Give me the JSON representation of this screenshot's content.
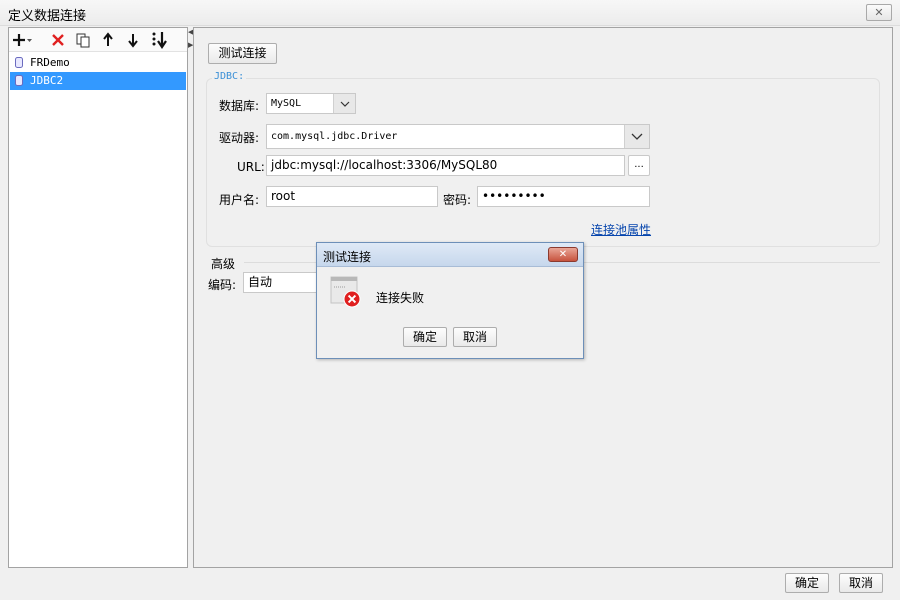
{
  "window": {
    "title": "定义数据连接",
    "close_glyph": "✕"
  },
  "toolbar": {
    "icons": [
      "add-icon",
      "delete-icon",
      "copy-icon",
      "move-up-icon",
      "move-down-icon",
      "sort-icon"
    ]
  },
  "tree": {
    "items": [
      {
        "label": "FRDemo",
        "selected": false
      },
      {
        "label": "JDBC2",
        "selected": true
      }
    ]
  },
  "form": {
    "test_button": "测试连接",
    "group_label": "JDBC:",
    "database_label": "数据库:",
    "database_value": "MySQL",
    "driver_label": "驱动器:",
    "driver_value": "com.mysql.jdbc.Driver",
    "url_label": "URL:",
    "url_value": "jdbc:mysql://localhost:3306/MySQL80",
    "url_browse": "...",
    "username_label": "用户名:",
    "username_value": "root",
    "password_label": "密码:",
    "password_value": "•••••••••",
    "pool_link": "连接池属性"
  },
  "advanced": {
    "title": "高级",
    "encoding_label": "编码:",
    "encoding_value": "自动"
  },
  "dialog": {
    "title": "测试连接",
    "close_glyph": "✕",
    "message": "连接失败",
    "ok": "确定",
    "cancel": "取消"
  },
  "footer": {
    "ok": "确定",
    "cancel": "取消"
  },
  "colors": {
    "selection": "#3399ff",
    "link": "#0645ad",
    "error": "#e02020",
    "legend": "#3a8fd6"
  }
}
